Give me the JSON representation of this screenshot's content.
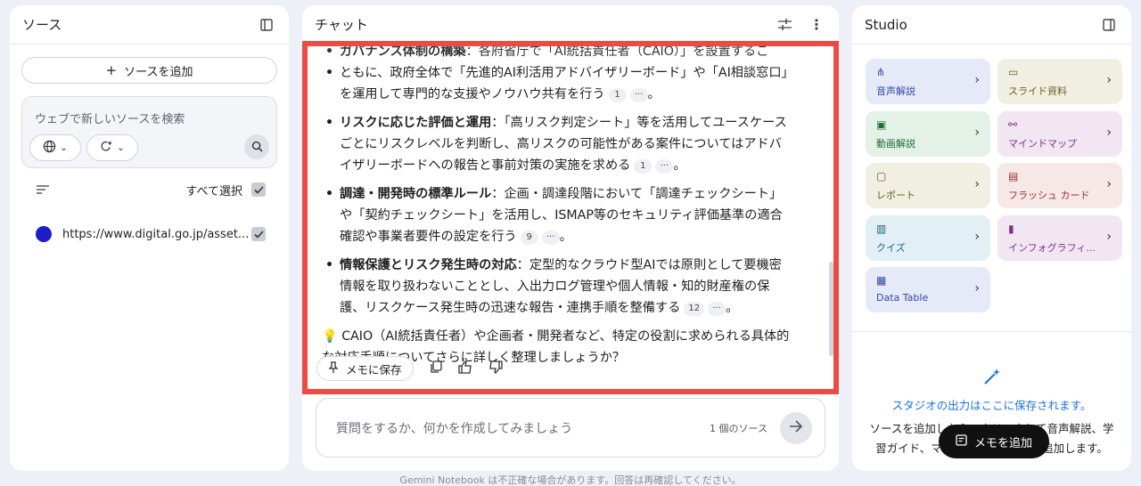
{
  "sources": {
    "title": "ソース",
    "add_label": "ソースを追加",
    "search_placeholder": "ウェブで新しいソースを検索",
    "select_all_label": "すべて選択",
    "items": [
      {
        "name": "https://www.digital.go.jp/asset...",
        "checked": true
      }
    ]
  },
  "chat": {
    "title": "チャット",
    "partial_top": "ともに、政府全体で「先進的AI利活用アドバイザリーボード」や「AI相談窓口」を運用して専門的な支援やノウハウ共有を行う",
    "partial_top_cite": "1",
    "points": [
      {
        "title": "リスクに応じた評価と運用",
        "text": "：「高リスク判定シート」等を活用してユースケースごとにリスクレベルを判断し、高リスクの可能性がある案件についてはアドバイザリーボードへの報告と事前対策の実施を求める",
        "cite": "1"
      },
      {
        "title": "調達・開発時の標準ルール",
        "text": "：企画・調達段階において「調達チェックシート」や「契約チェックシート」を活用し、ISMAP等のセキュリティ評価基準の適合確認や事業者要件の設定を行う",
        "cite": "9"
      },
      {
        "title": "情報保護とリスク発生時の対応",
        "text": "：定型的なクラウド型AIでは原則として要機密情報を取り扱わないこととし、入出力ログ管理や個人情報・知的財産権の保護、リスクケース発生時の迅速な報告・連携手順を整備する",
        "cite": "12"
      }
    ],
    "cite_more": "···",
    "followup": "CAIO（AI統括責任者）や企画者・開発者など、特定の役割に求められる具体的な対応手順についてさらに詳しく整理しましょうか？",
    "save_memo_label": "メモに保存",
    "input_placeholder": "質問をするか、何かを作成してみましょう",
    "source_count": "1 個のソース"
  },
  "studio": {
    "title": "Studio",
    "tiles": [
      {
        "label": "音声解説",
        "icon": "audio-icon",
        "bg": "#e6eaf8",
        "fg": "#3446a8"
      },
      {
        "label": "スライド資料",
        "icon": "slides-icon",
        "bg": "#f1efe2",
        "fg": "#6b5d1e"
      },
      {
        "label": "動画解説",
        "icon": "video-icon",
        "bg": "#e3f1e6",
        "fg": "#1f6b36"
      },
      {
        "label": "マインドマップ",
        "icon": "mindmap-icon",
        "bg": "#f1e6f2",
        "fg": "#7a3486"
      },
      {
        "label": "レポート",
        "icon": "report-icon",
        "bg": "#f1efe2",
        "fg": "#6b5d1e"
      },
      {
        "label": "フラッシュ カード",
        "icon": "flashcard-icon",
        "bg": "#f7e8e8",
        "fg": "#9a2f2f"
      },
      {
        "label": "クイズ",
        "icon": "quiz-icon",
        "bg": "#e2f0f6",
        "fg": "#1e5f7a"
      },
      {
        "label": "インフォグラフィ...",
        "icon": "infographic-icon",
        "bg": "#f1e6f2",
        "fg": "#7a3486"
      },
      {
        "label": "Data Table",
        "icon": "table-icon",
        "bg": "#e6eaf8",
        "fg": "#3446a8"
      }
    ],
    "empty_title": "スタジオの出力はここに保存されます。",
    "empty_desc": "ソースを追加したら、クリックして音声解説、学習ガイド、マインドマップなどを追加します。",
    "memo_button_label": "メモを追加"
  },
  "footer": "Gemini Notebook は不正確な場合があります。回答は再確認してください。"
}
